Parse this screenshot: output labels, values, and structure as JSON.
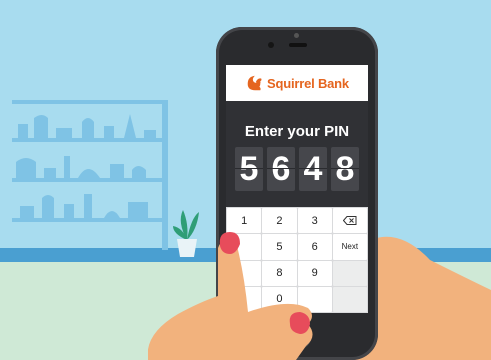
{
  "app": {
    "brand_name": "Squirrel Bank",
    "brand_color": "#e5651f",
    "logo_icon": "squirrel-icon"
  },
  "pin_screen": {
    "title": "Enter your PIN",
    "digits": [
      "5",
      "6",
      "4",
      "8"
    ]
  },
  "keypad": {
    "keys": [
      "1",
      "2",
      "3",
      "",
      "",
      "5",
      "6",
      "Next",
      "",
      "8",
      "9",
      "",
      "",
      "0",
      "",
      ""
    ],
    "backspace_icon": "backspace-icon"
  }
}
